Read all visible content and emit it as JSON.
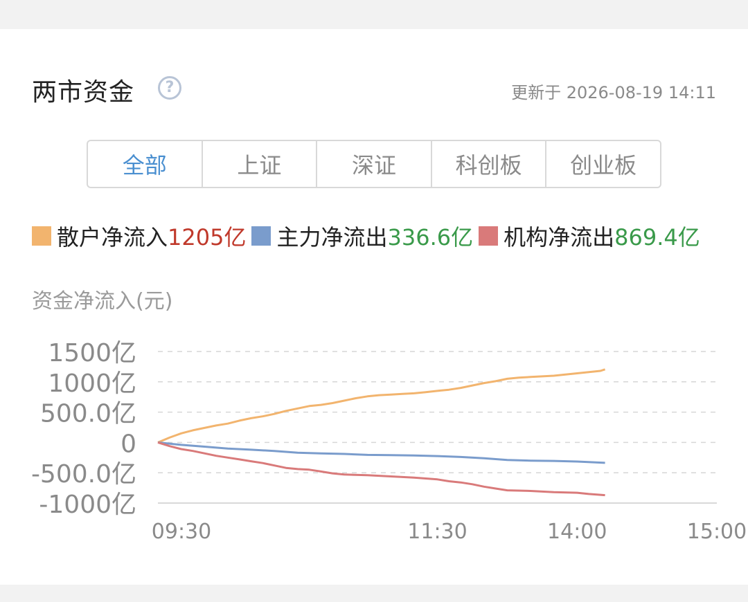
{
  "header": {
    "title": "两市资金",
    "help_icon": "question-circle-icon",
    "updated": "更新于 2026-08-19 14:11"
  },
  "tabs": [
    {
      "label": "全部",
      "active": true
    },
    {
      "label": "上证",
      "active": false
    },
    {
      "label": "深证",
      "active": false
    },
    {
      "label": "科创板",
      "active": false
    },
    {
      "label": "创业板",
      "active": false
    }
  ],
  "legend": [
    {
      "label": "散户净流入",
      "value": "1205亿",
      "color": "#f2b46e",
      "value_color": "#c0392b"
    },
    {
      "label": "主力净流出",
      "value": "336.6亿",
      "color": "#7a9ccc",
      "value_color": "#3a9a4a"
    },
    {
      "label": "机构净流出",
      "value": "869.4亿",
      "color": "#d97a7a",
      "value_color": "#3a9a4a"
    }
  ],
  "chart_data": {
    "type": "line",
    "ylabel": "资金净流入(元)",
    "yticks": [
      {
        "value": 1500,
        "label": "1500亿"
      },
      {
        "value": 1000,
        "label": "1000亿"
      },
      {
        "value": 500,
        "label": "500.0亿"
      },
      {
        "value": 0,
        "label": "0"
      },
      {
        "value": -500,
        "label": "-500.0亿"
      },
      {
        "value": -1000,
        "label": "-1000亿"
      }
    ],
    "ylim": [
      -1000,
      1500
    ],
    "xticks": [
      "09:30",
      "11:30",
      "14:00",
      "15:00"
    ],
    "x_minutes_range": [
      0,
      240
    ],
    "x_tick_minutes": [
      0,
      120,
      180,
      240
    ],
    "grid": true,
    "series": [
      {
        "name": "散户净流入",
        "color": "#f2b46e",
        "points": [
          [
            0,
            0
          ],
          [
            5,
            80
          ],
          [
            10,
            150
          ],
          [
            15,
            200
          ],
          [
            20,
            240
          ],
          [
            25,
            280
          ],
          [
            30,
            310
          ],
          [
            35,
            360
          ],
          [
            40,
            400
          ],
          [
            45,
            430
          ],
          [
            50,
            470
          ],
          [
            55,
            520
          ],
          [
            60,
            560
          ],
          [
            65,
            600
          ],
          [
            70,
            620
          ],
          [
            75,
            650
          ],
          [
            80,
            690
          ],
          [
            85,
            730
          ],
          [
            90,
            760
          ],
          [
            95,
            780
          ],
          [
            100,
            790
          ],
          [
            105,
            800
          ],
          [
            110,
            810
          ],
          [
            115,
            830
          ],
          [
            120,
            850
          ],
          [
            125,
            870
          ],
          [
            130,
            900
          ],
          [
            135,
            940
          ],
          [
            140,
            980
          ],
          [
            145,
            1010
          ],
          [
            150,
            1050
          ],
          [
            155,
            1070
          ],
          [
            160,
            1080
          ],
          [
            165,
            1090
          ],
          [
            170,
            1100
          ],
          [
            175,
            1120
          ],
          [
            180,
            1140
          ],
          [
            185,
            1160
          ],
          [
            190,
            1180
          ],
          [
            192,
            1205
          ]
        ]
      },
      {
        "name": "主力净流出",
        "color": "#7a9ccc",
        "points": [
          [
            0,
            0
          ],
          [
            10,
            -40
          ],
          [
            20,
            -70
          ],
          [
            30,
            -100
          ],
          [
            40,
            -120
          ],
          [
            50,
            -140
          ],
          [
            60,
            -170
          ],
          [
            70,
            -180
          ],
          [
            80,
            -190
          ],
          [
            90,
            -205
          ],
          [
            100,
            -210
          ],
          [
            110,
            -215
          ],
          [
            120,
            -225
          ],
          [
            130,
            -240
          ],
          [
            140,
            -260
          ],
          [
            150,
            -290
          ],
          [
            160,
            -300
          ],
          [
            170,
            -305
          ],
          [
            180,
            -315
          ],
          [
            192,
            -336.6
          ]
        ]
      },
      {
        "name": "机构净流出",
        "color": "#d97a7a",
        "points": [
          [
            0,
            0
          ],
          [
            5,
            -60
          ],
          [
            10,
            -110
          ],
          [
            15,
            -140
          ],
          [
            20,
            -180
          ],
          [
            25,
            -220
          ],
          [
            30,
            -250
          ],
          [
            35,
            -280
          ],
          [
            40,
            -310
          ],
          [
            45,
            -340
          ],
          [
            50,
            -380
          ],
          [
            55,
            -420
          ],
          [
            60,
            -440
          ],
          [
            65,
            -450
          ],
          [
            70,
            -480
          ],
          [
            75,
            -510
          ],
          [
            80,
            -530
          ],
          [
            90,
            -540
          ],
          [
            100,
            -560
          ],
          [
            110,
            -580
          ],
          [
            120,
            -610
          ],
          [
            125,
            -640
          ],
          [
            130,
            -660
          ],
          [
            135,
            -690
          ],
          [
            140,
            -730
          ],
          [
            145,
            -760
          ],
          [
            150,
            -790
          ],
          [
            160,
            -800
          ],
          [
            170,
            -820
          ],
          [
            180,
            -830
          ],
          [
            185,
            -850
          ],
          [
            192,
            -869.4
          ]
        ]
      }
    ]
  }
}
